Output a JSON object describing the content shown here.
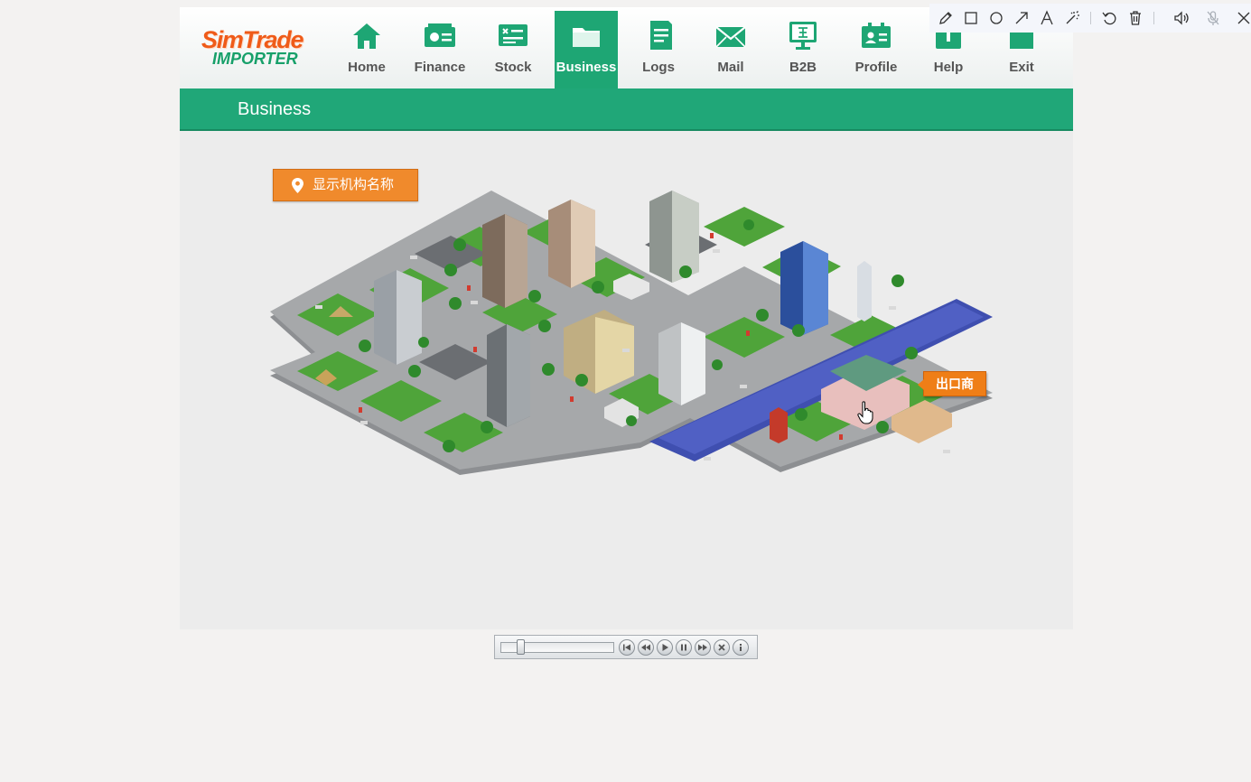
{
  "app": {
    "logo": {
      "brand": "SimTrade",
      "product": "IMPORTER"
    },
    "nav": [
      {
        "label": "Home",
        "icon": "home-icon"
      },
      {
        "label": "Finance",
        "icon": "finance-icon"
      },
      {
        "label": "Stock",
        "icon": "stock-icon"
      },
      {
        "label": "Business",
        "icon": "folder-icon",
        "active": true
      },
      {
        "label": "Logs",
        "icon": "logs-icon"
      },
      {
        "label": "Mail",
        "icon": "mail-icon"
      },
      {
        "label": "B2B",
        "icon": "b2b-monitor-icon"
      },
      {
        "label": "Profile",
        "icon": "profile-card-icon"
      },
      {
        "label": "Help",
        "icon": "help-icon"
      },
      {
        "label": "Exit",
        "icon": "exit-icon"
      }
    ],
    "section_title": "Business",
    "show_names_button": "显示机构名称",
    "hover_tooltip": "出口商",
    "colors": {
      "brand_green": "#20a778",
      "accent_orange": "#f08a2c",
      "logo_orange": "#ef5b19"
    }
  },
  "player": {
    "seek_fraction": 0.15,
    "controls": [
      "skip-to-start",
      "rewind",
      "play",
      "pause",
      "fast-forward",
      "stop",
      "info"
    ]
  },
  "annotation_toolbar": {
    "tools": [
      "pencil",
      "rectangle",
      "circle",
      "arrow",
      "text",
      "magic-wand",
      "undo",
      "delete",
      "speaker",
      "microphone-muted",
      "close"
    ]
  }
}
